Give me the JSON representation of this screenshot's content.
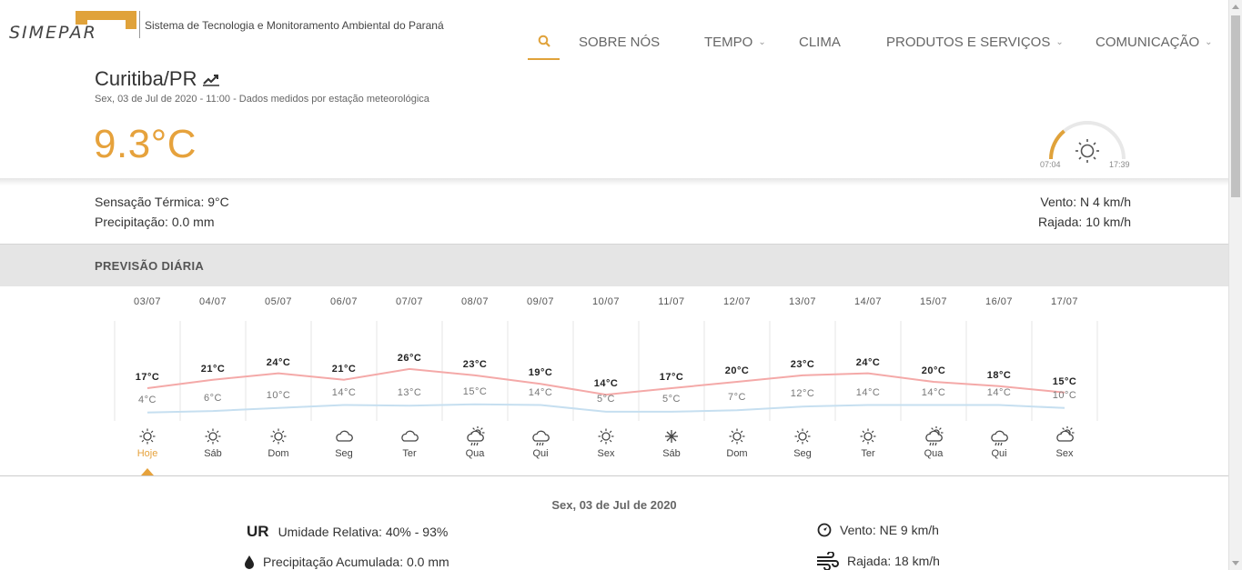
{
  "header": {
    "logo_text": "SIMEPAR",
    "subtitle": "Sistema de Tecnologia e Monitoramento Ambiental do Paraná",
    "nav": [
      {
        "label": "SOBRE NÓS",
        "has_dropdown": false
      },
      {
        "label": "TEMPO",
        "has_dropdown": true
      },
      {
        "label": "CLIMA",
        "has_dropdown": false
      },
      {
        "label": "PRODUTOS E SERVIÇOS",
        "has_dropdown": true
      },
      {
        "label": "COMUNICAÇÃO",
        "has_dropdown": true
      }
    ],
    "accent_color": "#e0a23a"
  },
  "current": {
    "city": "Curitiba/PR",
    "subline": "Sex, 03 de Jul de 2020 - 11:00 - Dados medidos por estação meteorológica",
    "temperature": "9.3°C",
    "sunrise": "07:04",
    "sunset": "17:39",
    "sun_progress": 0.28,
    "feels_like": "Sensação Térmica: 9°C",
    "precipitation": "Precipitação: 0.0 mm",
    "wind": "Vento: N 4 km/h",
    "gust": "Rajada: 10 km/h"
  },
  "forecast": {
    "title": "PREVISÃO DIÁRIA",
    "days": [
      {
        "date": "03/07",
        "max": "17°C",
        "min": "4°C",
        "name": "Hoje",
        "icon": "sun-icon",
        "max_v": 17,
        "min_v": 4
      },
      {
        "date": "04/07",
        "max": "21°C",
        "min": "6°C",
        "name": "Sáb",
        "icon": "sun-icon",
        "max_v": 21,
        "min_v": 6
      },
      {
        "date": "05/07",
        "max": "24°C",
        "min": "10°C",
        "name": "Dom",
        "icon": "sun-icon",
        "max_v": 24,
        "min_v": 10
      },
      {
        "date": "06/07",
        "max": "21°C",
        "min": "14°C",
        "name": "Seg",
        "icon": "cloud-icon",
        "max_v": 21,
        "min_v": 14
      },
      {
        "date": "07/07",
        "max": "26°C",
        "min": "13°C",
        "name": "Ter",
        "icon": "cloud-icon",
        "max_v": 26,
        "min_v": 13
      },
      {
        "date": "08/07",
        "max": "23°C",
        "min": "15°C",
        "name": "Qua",
        "icon": "sun-cloud-rain-icon",
        "max_v": 23,
        "min_v": 15
      },
      {
        "date": "09/07",
        "max": "19°C",
        "min": "14°C",
        "name": "Qui",
        "icon": "cloud-rain-icon",
        "max_v": 19,
        "min_v": 14
      },
      {
        "date": "10/07",
        "max": "14°C",
        "min": "5°C",
        "name": "Sex",
        "icon": "sun-icon",
        "max_v": 14,
        "min_v": 5
      },
      {
        "date": "11/07",
        "max": "17°C",
        "min": "5°C",
        "name": "Sáb",
        "icon": "frost-icon",
        "max_v": 17,
        "min_v": 5
      },
      {
        "date": "12/07",
        "max": "20°C",
        "min": "7°C",
        "name": "Dom",
        "icon": "sun-icon",
        "max_v": 20,
        "min_v": 7
      },
      {
        "date": "13/07",
        "max": "23°C",
        "min": "12°C",
        "name": "Seg",
        "icon": "sun-icon",
        "max_v": 23,
        "min_v": 12
      },
      {
        "date": "14/07",
        "max": "24°C",
        "min": "14°C",
        "name": "Ter",
        "icon": "sun-icon",
        "max_v": 24,
        "min_v": 14
      },
      {
        "date": "15/07",
        "max": "20°C",
        "min": "14°C",
        "name": "Qua",
        "icon": "sun-cloud-rain-icon",
        "max_v": 20,
        "min_v": 14
      },
      {
        "date": "16/07",
        "max": "18°C",
        "min": "14°C",
        "name": "Qui",
        "icon": "cloud-rain-icon",
        "max_v": 18,
        "min_v": 14
      },
      {
        "date": "17/07",
        "max": "15°C",
        "min": "10°C",
        "name": "Sex",
        "icon": "sun-cloud-icon",
        "max_v": 15,
        "min_v": 10
      }
    ],
    "max_color": "#f4a9a8",
    "min_color": "#c6dff0"
  },
  "details": {
    "date": "Sex, 03 de Jul de 2020",
    "ur_tag": "UR",
    "humidity": "Umidade Relativa: 40% - 93%",
    "precip_acc": "Precipitação Acumulada: 0.0 mm",
    "wind": "Vento: NE 9 km/h",
    "gust": "Rajada: 18 km/h"
  }
}
